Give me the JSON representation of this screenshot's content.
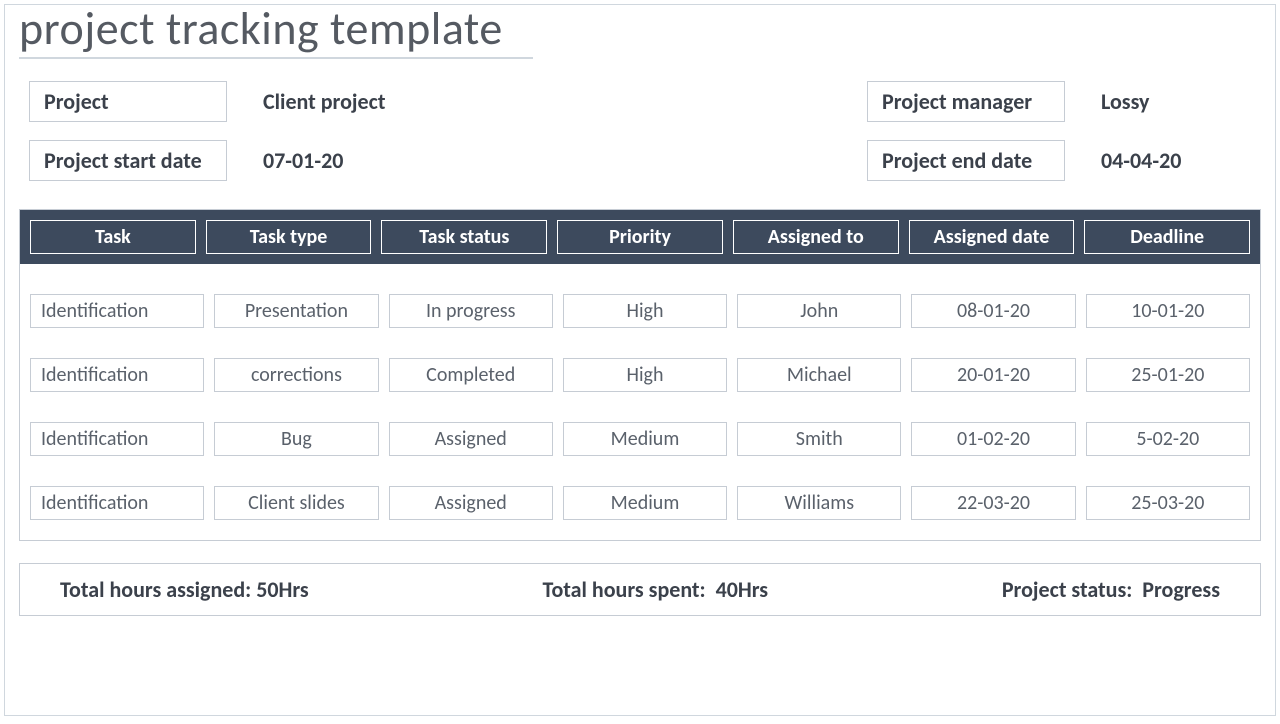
{
  "title": "project tracking template",
  "meta": {
    "project_label": "Project",
    "project_value": "Client project",
    "manager_label": "Project manager",
    "manager_value": "Lossy",
    "start_label": "Project start date",
    "start_value": "07-01-20",
    "end_label": "Project end date",
    "end_value": "04-04-20"
  },
  "columns": [
    "Task",
    "Task type",
    "Task status",
    "Priority",
    "Assigned to",
    "Assigned date",
    "Deadline"
  ],
  "rows": [
    {
      "task": "Identification",
      "type": "Presentation",
      "status": "In progress",
      "priority": "High",
      "assignee": "John",
      "assigned": "08-01-20",
      "deadline": "10-01-20"
    },
    {
      "task": "Identification",
      "type": "corrections",
      "status": "Completed",
      "priority": "High",
      "assignee": "Michael",
      "assigned": "20-01-20",
      "deadline": "25-01-20"
    },
    {
      "task": "Identification",
      "type": "Bug",
      "status": "Assigned",
      "priority": "Medium",
      "assignee": "Smith",
      "assigned": "01-02-20",
      "deadline": "5-02-20"
    },
    {
      "task": "Identification",
      "type": "Client slides",
      "status": "Assigned",
      "priority": "Medium",
      "assignee": "Williams",
      "assigned": "22-03-20",
      "deadline": "25-03-20"
    }
  ],
  "footer": {
    "hours_assigned_label": "Total hours assigned:",
    "hours_assigned_value": "50Hrs",
    "hours_spent_label": "Total hours spent:",
    "hours_spent_value": "40Hrs",
    "status_label": "Project status:",
    "status_value": "Progress"
  }
}
